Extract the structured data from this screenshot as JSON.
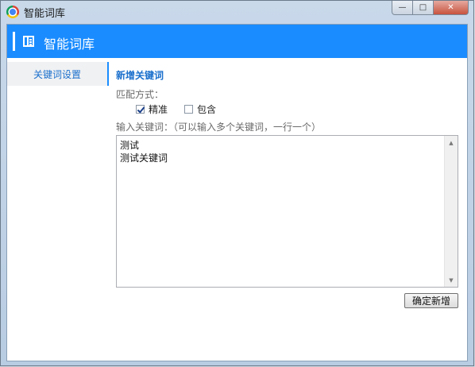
{
  "window": {
    "title": "智能词库",
    "buttons": {
      "minimize": "—",
      "maximize": "□",
      "close": "✕"
    }
  },
  "header": {
    "title": "智能词库",
    "icon": "sidebar-panel-icon"
  },
  "sidebar": {
    "items": [
      {
        "label": "关键词设置",
        "active": true
      }
    ]
  },
  "form": {
    "section_title": "新增关键词",
    "match_label": "匹配方式：",
    "options": [
      {
        "label": "精准",
        "checked": true
      },
      {
        "label": "包含",
        "checked": false
      }
    ],
    "keywords_label": "输入关键词：（可以输入多个关键词，一行一个）",
    "keywords_lines": [
      "测试",
      "测试关键词"
    ],
    "confirm_label": "确定新增"
  },
  "colors": {
    "accent": "#1a8cff",
    "link": "#1a6fcc"
  }
}
